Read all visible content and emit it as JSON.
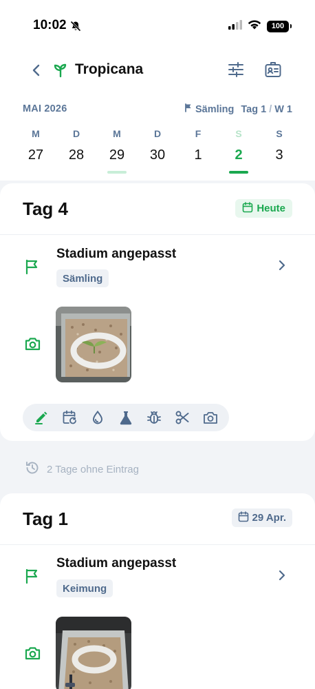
{
  "status": {
    "time": "10:02",
    "battery": "100"
  },
  "header": {
    "title": "Tropicana"
  },
  "calendar": {
    "month": "MAI 2026",
    "stage": "Sämling",
    "day_label": "Tag 1",
    "separator": "/",
    "week_label": "W 1",
    "days": [
      {
        "letter": "M",
        "num": "27"
      },
      {
        "letter": "D",
        "num": "28"
      },
      {
        "letter": "M",
        "num": "29"
      },
      {
        "letter": "D",
        "num": "30"
      },
      {
        "letter": "F",
        "num": "1"
      },
      {
        "letter": "S",
        "num": "2"
      },
      {
        "letter": "S",
        "num": "3"
      }
    ]
  },
  "day4": {
    "title": "Tag 4",
    "badge": "Heute",
    "entry_title": "Stadium angepasst",
    "stage": "Sämling"
  },
  "gap_text": "2 Tage ohne Eintrag",
  "day1": {
    "title": "Tag 1",
    "badge": "29 Apr.",
    "entry_title": "Stadium angepasst",
    "stage": "Keimung"
  },
  "colors": {
    "accent": "#1aa84f",
    "muted": "#5b7698"
  }
}
